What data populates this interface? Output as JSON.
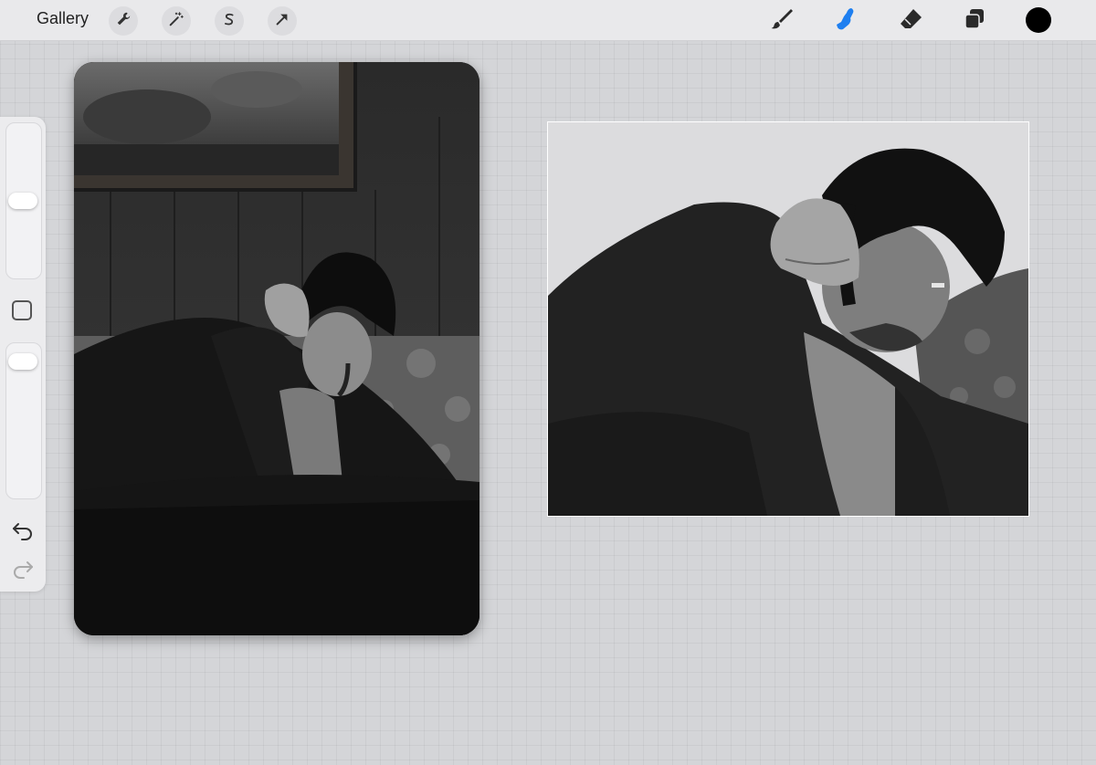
{
  "toolbar": {
    "gallery_label": "Gallery",
    "left_tools": [
      {
        "name": "actions",
        "icon": "wrench-icon"
      },
      {
        "name": "adjustments",
        "icon": "magic-wand-icon"
      },
      {
        "name": "selection",
        "icon": "selection-s-icon"
      },
      {
        "name": "transform",
        "icon": "arrow-cursor-icon"
      }
    ],
    "right_tools": [
      {
        "name": "brush",
        "icon": "brush-icon",
        "active": false
      },
      {
        "name": "smudge",
        "icon": "smudge-finger-icon",
        "active": true
      },
      {
        "name": "eraser",
        "icon": "eraser-icon",
        "active": false
      },
      {
        "name": "layers",
        "icon": "layers-icon",
        "active": false
      }
    ],
    "current_color": "#000000",
    "accent_color": "#1e7ff0"
  },
  "sidebar": {
    "brush_size_level": 0.5,
    "opacity_level": 0.95,
    "controls": [
      {
        "name": "modify",
        "icon": "square-modify-icon"
      },
      {
        "name": "undo",
        "icon": "undo-arrow-icon"
      },
      {
        "name": "redo",
        "icon": "redo-arrow-icon",
        "enabled": false
      }
    ]
  },
  "reference_window": {
    "content": "reference-photo-image"
  },
  "canvas": {
    "content": "digital-painting-artwork"
  }
}
